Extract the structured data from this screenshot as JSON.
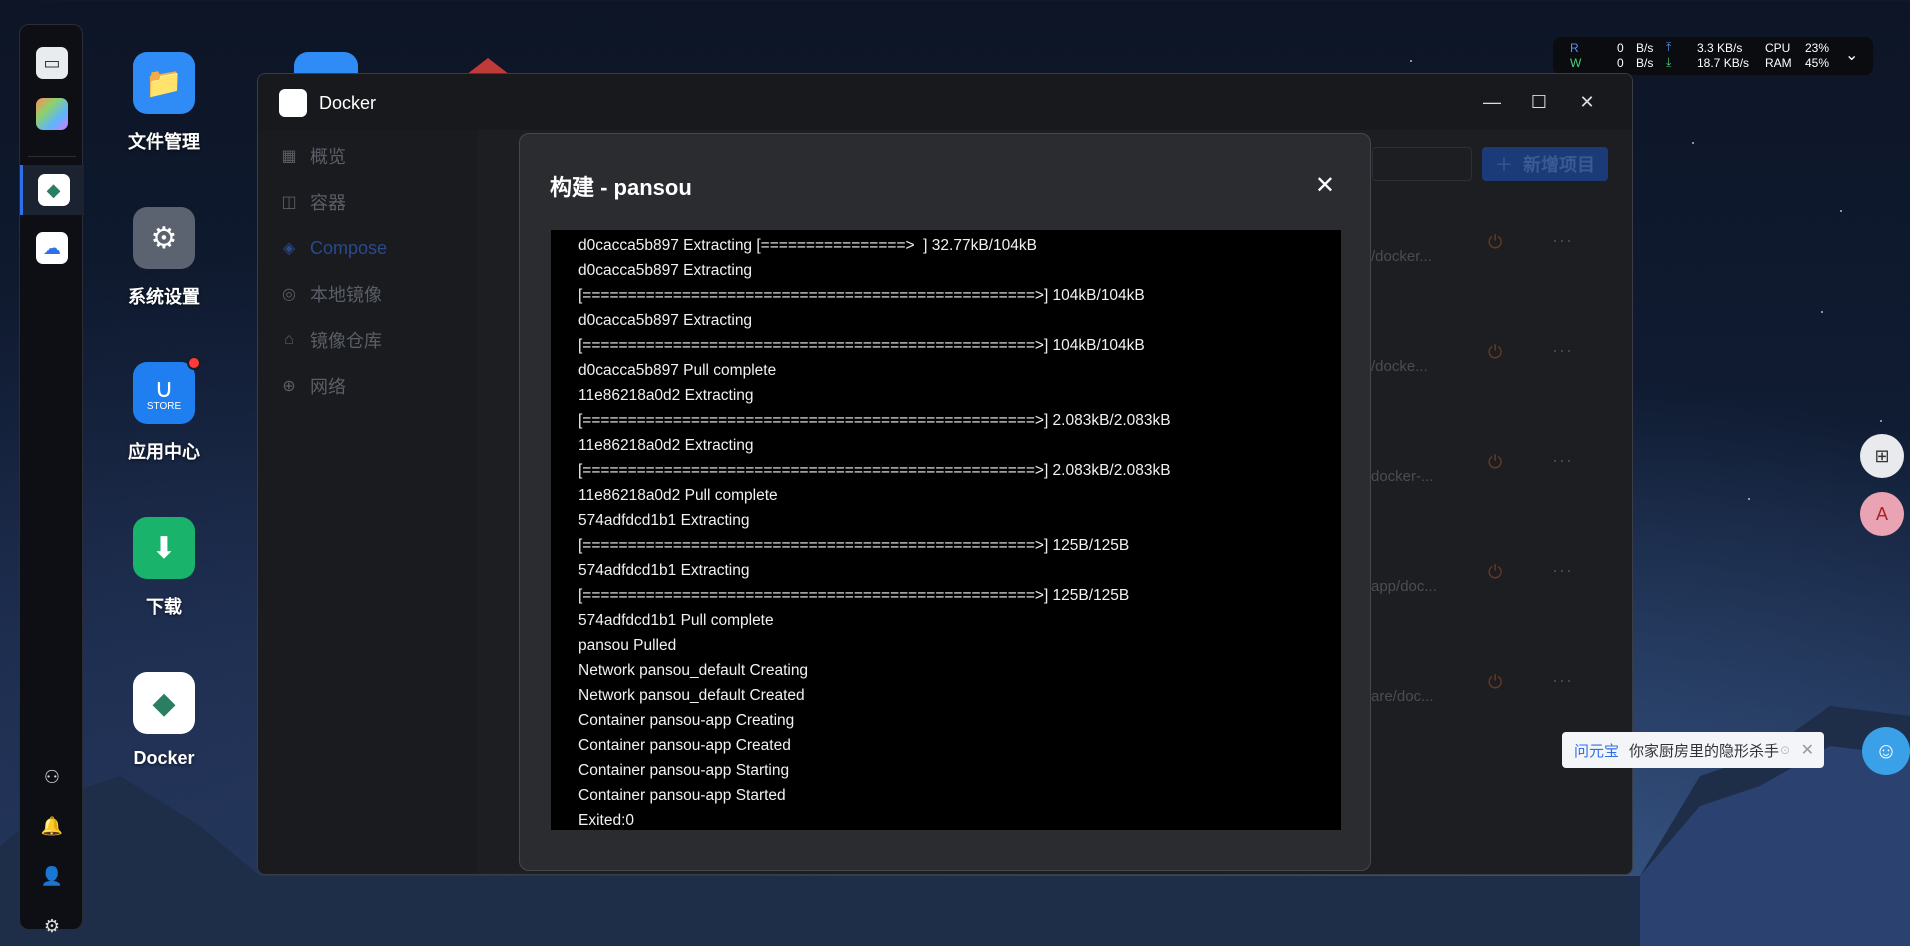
{
  "desktop": {
    "icons": [
      {
        "label": "文件管理",
        "icon": "folder-icon",
        "color": "#2f8cf6"
      },
      {
        "label": "系统设置",
        "icon": "gear-icon",
        "color": "#5b6370"
      },
      {
        "label": "应用中心",
        "icon": "store-icon",
        "color": "#1f7ff0",
        "sub": "STORE"
      },
      {
        "label": "下载",
        "icon": "download-icon",
        "color": "#19b36b"
      },
      {
        "label": "Docker",
        "icon": "docker-icon",
        "color": "#ffffff"
      }
    ]
  },
  "stats": {
    "r_label": "R",
    "w_label": "W",
    "r_value": "0",
    "w_value": "0",
    "r_unit": "B/s",
    "w_unit": "B/s",
    "up_speed": "3.3 KB/s",
    "down_speed": "18.7 KB/s",
    "cpu_label": "CPU",
    "cpu_value": "23%",
    "ram_label": "RAM",
    "ram_value": "45%"
  },
  "window": {
    "title": "Docker",
    "sidebar": [
      {
        "label": "概览",
        "icon": "grid-icon"
      },
      {
        "label": "容器",
        "icon": "box-icon"
      },
      {
        "label": "Compose",
        "icon": "layers-icon"
      },
      {
        "label": "本地镜像",
        "icon": "disc-icon"
      },
      {
        "label": "镜像仓库",
        "icon": "home-icon"
      },
      {
        "label": "网络",
        "icon": "globe-icon"
      }
    ],
    "new_project_label": "新增项目",
    "rows": [
      {
        "path": "/docker..."
      },
      {
        "path": "/docke..."
      },
      {
        "path": "docker-..."
      },
      {
        "path": "app/doc..."
      },
      {
        "path": "are/doc..."
      }
    ]
  },
  "modal": {
    "title": "构建 - pansou",
    "log_lines": [
      "d0cacca5b897 Extracting [================>  ] 32.77kB/104kB",
      "d0cacca5b897 Extracting",
      "[==================================================>] 104kB/104kB",
      "d0cacca5b897 Extracting",
      "[==================================================>] 104kB/104kB",
      "d0cacca5b897 Pull complete",
      "11e86218a0d2 Extracting",
      "[==================================================>] 2.083kB/2.083kB",
      "11e86218a0d2 Extracting",
      "[==================================================>] 2.083kB/2.083kB",
      "11e86218a0d2 Pull complete",
      "574adfdcd1b1 Extracting",
      "[==================================================>] 125B/125B",
      "574adfdcd1b1 Extracting",
      "[==================================================>] 125B/125B",
      "574adfdcd1b1 Pull complete",
      "pansou Pulled",
      "Network pansou_default Creating",
      "Network pansou_default Created",
      "Container pansou-app Creating",
      "Container pansou-app Created",
      "Container pansou-app Starting",
      "Container pansou-app Started",
      "Exited:0"
    ]
  },
  "tip": {
    "brand": "问元宝",
    "text": "你家厨房里的隐形杀手"
  }
}
